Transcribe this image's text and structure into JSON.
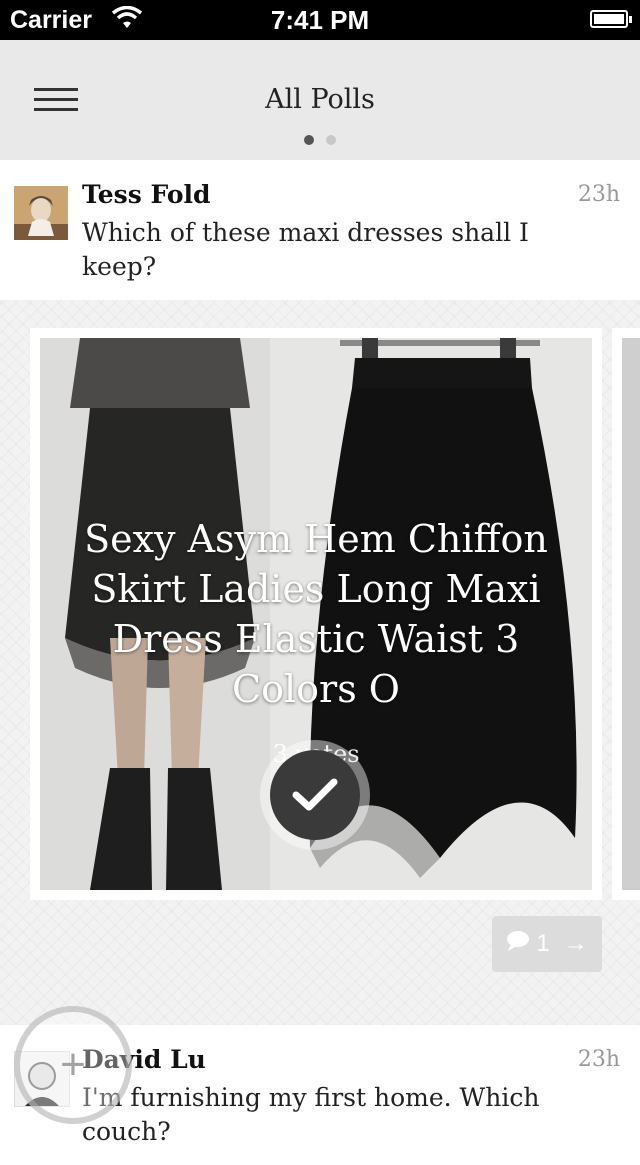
{
  "status_bar": {
    "carrier": "Carrier",
    "time": "7:41 PM"
  },
  "nav": {
    "title": "All Polls",
    "page_dots": 2,
    "active_dot": 1
  },
  "posts": [
    {
      "author": "Tess Fold",
      "time_ago": "23h",
      "question": "Which of these maxi dresses shall I keep?",
      "option": {
        "title": "Sexy Asym Hem Chiffon Skirt Ladies Long Maxi Dress Elastic Waist 3 Colors O",
        "votes": "3 votes"
      },
      "comments": {
        "count": "1",
        "arrow": "→"
      }
    },
    {
      "author": "David Lu",
      "time_ago": "23h",
      "question": "I'm furnishing my first home. Which couch?"
    }
  ],
  "fab": {
    "symbol": "+"
  },
  "colors": {
    "nav_bg": "#e9e9e9",
    "card_bg": "#ffffff",
    "check_bg": "#3a3a3a"
  }
}
